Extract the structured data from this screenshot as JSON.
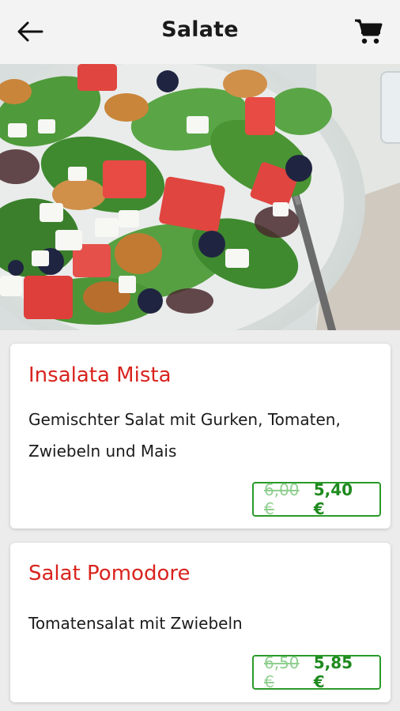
{
  "header": {
    "title": "Salate",
    "back_icon": "arrow-left-icon",
    "cart_icon": "shopping-cart-icon"
  },
  "hero": {
    "image": "salad-bowl-photo"
  },
  "products": [
    {
      "name": "Insalata Mista",
      "description": "Gemischter Salat mit Gurken, Tomaten, Zwiebeln und Mais",
      "old_price": "6,00 €",
      "new_price": "5,40 €"
    },
    {
      "name": "Salat Pomodore",
      "description": "Tomatensalat mit Zwiebeln",
      "old_price": "6,50 €",
      "new_price": "5,85 €"
    }
  ],
  "colors": {
    "accent_red": "#d9231d",
    "price_green": "#1e8a1e",
    "old_price_green": "#8fcf8f"
  }
}
